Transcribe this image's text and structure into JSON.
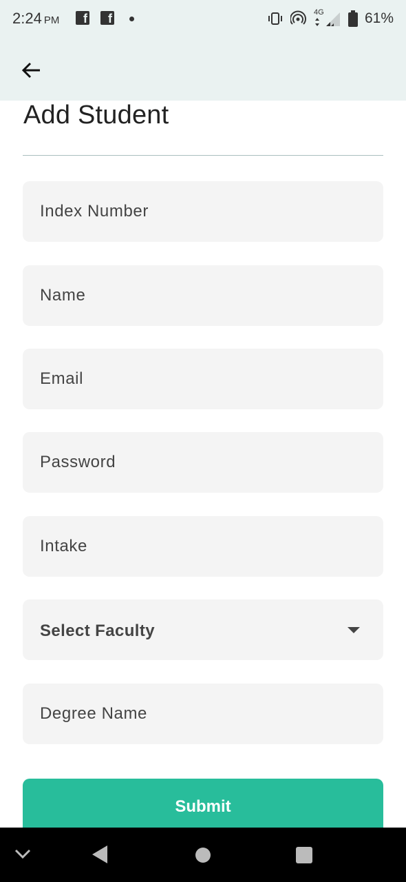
{
  "status_bar": {
    "time": "2:24",
    "ampm": "PM",
    "network": "4G",
    "battery": "61%"
  },
  "page": {
    "title": "Add Student"
  },
  "form": {
    "index_number_placeholder": "Index Number",
    "name_placeholder": "Name",
    "email_placeholder": "Email",
    "password_placeholder": "Password",
    "intake_placeholder": "Intake",
    "faculty_select_label": "Select Faculty",
    "degree_name_placeholder": "Degree Name",
    "submit_label": "Submit"
  },
  "colors": {
    "accent": "#28bd9b",
    "appbar_background": "#eaf2f1",
    "field_background": "#f4f4f4"
  },
  "icons": {
    "back": "arrow-left-icon",
    "nav_down": "chevron-down-icon",
    "nav_back": "triangle-back-icon",
    "nav_home": "circle-home-icon",
    "nav_recents": "square-recents-icon"
  }
}
